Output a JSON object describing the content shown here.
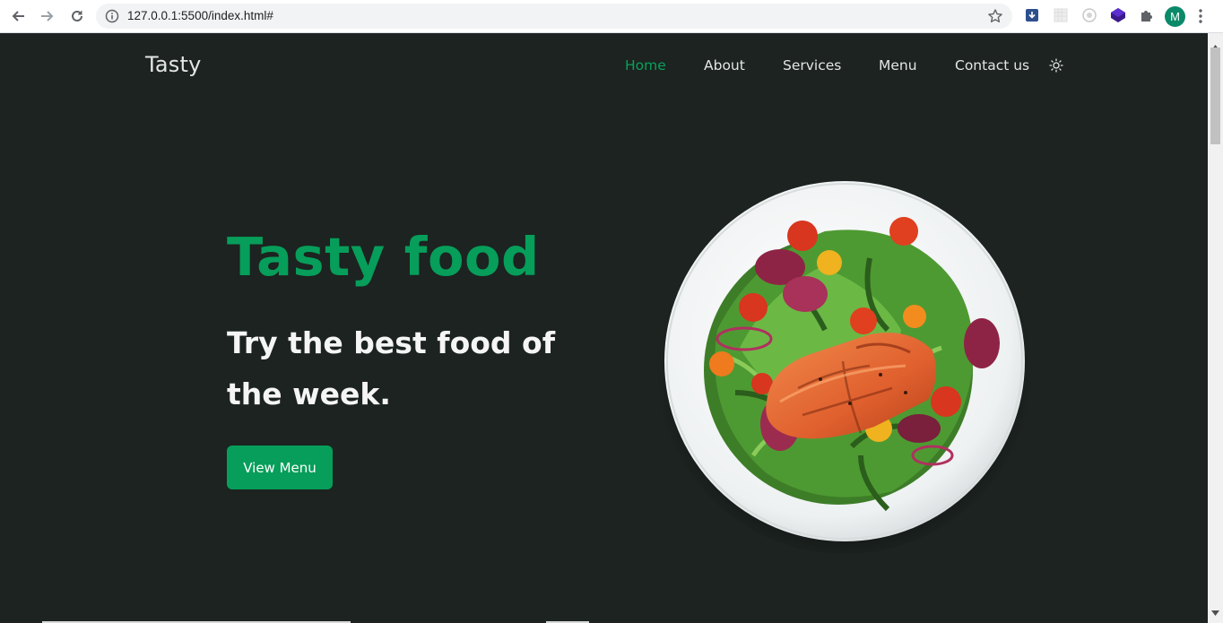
{
  "browser": {
    "url": "127.0.0.1:5500/index.html#",
    "profile_initial": "M",
    "icons": [
      "back-arrow-icon",
      "forward-arrow-icon",
      "reload-icon",
      "site-info-icon",
      "bookmark-star-icon",
      "download-extension-icon",
      "grid-extension-icon",
      "refresh-extension-icon",
      "purple-extension-icon",
      "puzzle-extension-icon",
      "kebab-menu-icon"
    ]
  },
  "header": {
    "logo": "Tasty",
    "nav": [
      {
        "label": "Home",
        "active": true
      },
      {
        "label": "About",
        "active": false
      },
      {
        "label": "Services",
        "active": false
      },
      {
        "label": "Menu",
        "active": false
      },
      {
        "label": "Contact us",
        "active": false
      }
    ],
    "theme_toggle_icon": "sun-icon"
  },
  "hero": {
    "title": "Tasty food",
    "subtitle": "Try the best food of the week.",
    "cta_label": "View Menu",
    "image_icon": "salmon-salad-plate-image"
  },
  "colors": {
    "background": "#1c2320",
    "accent": "#069e5a",
    "text": "#f4f5f4"
  }
}
